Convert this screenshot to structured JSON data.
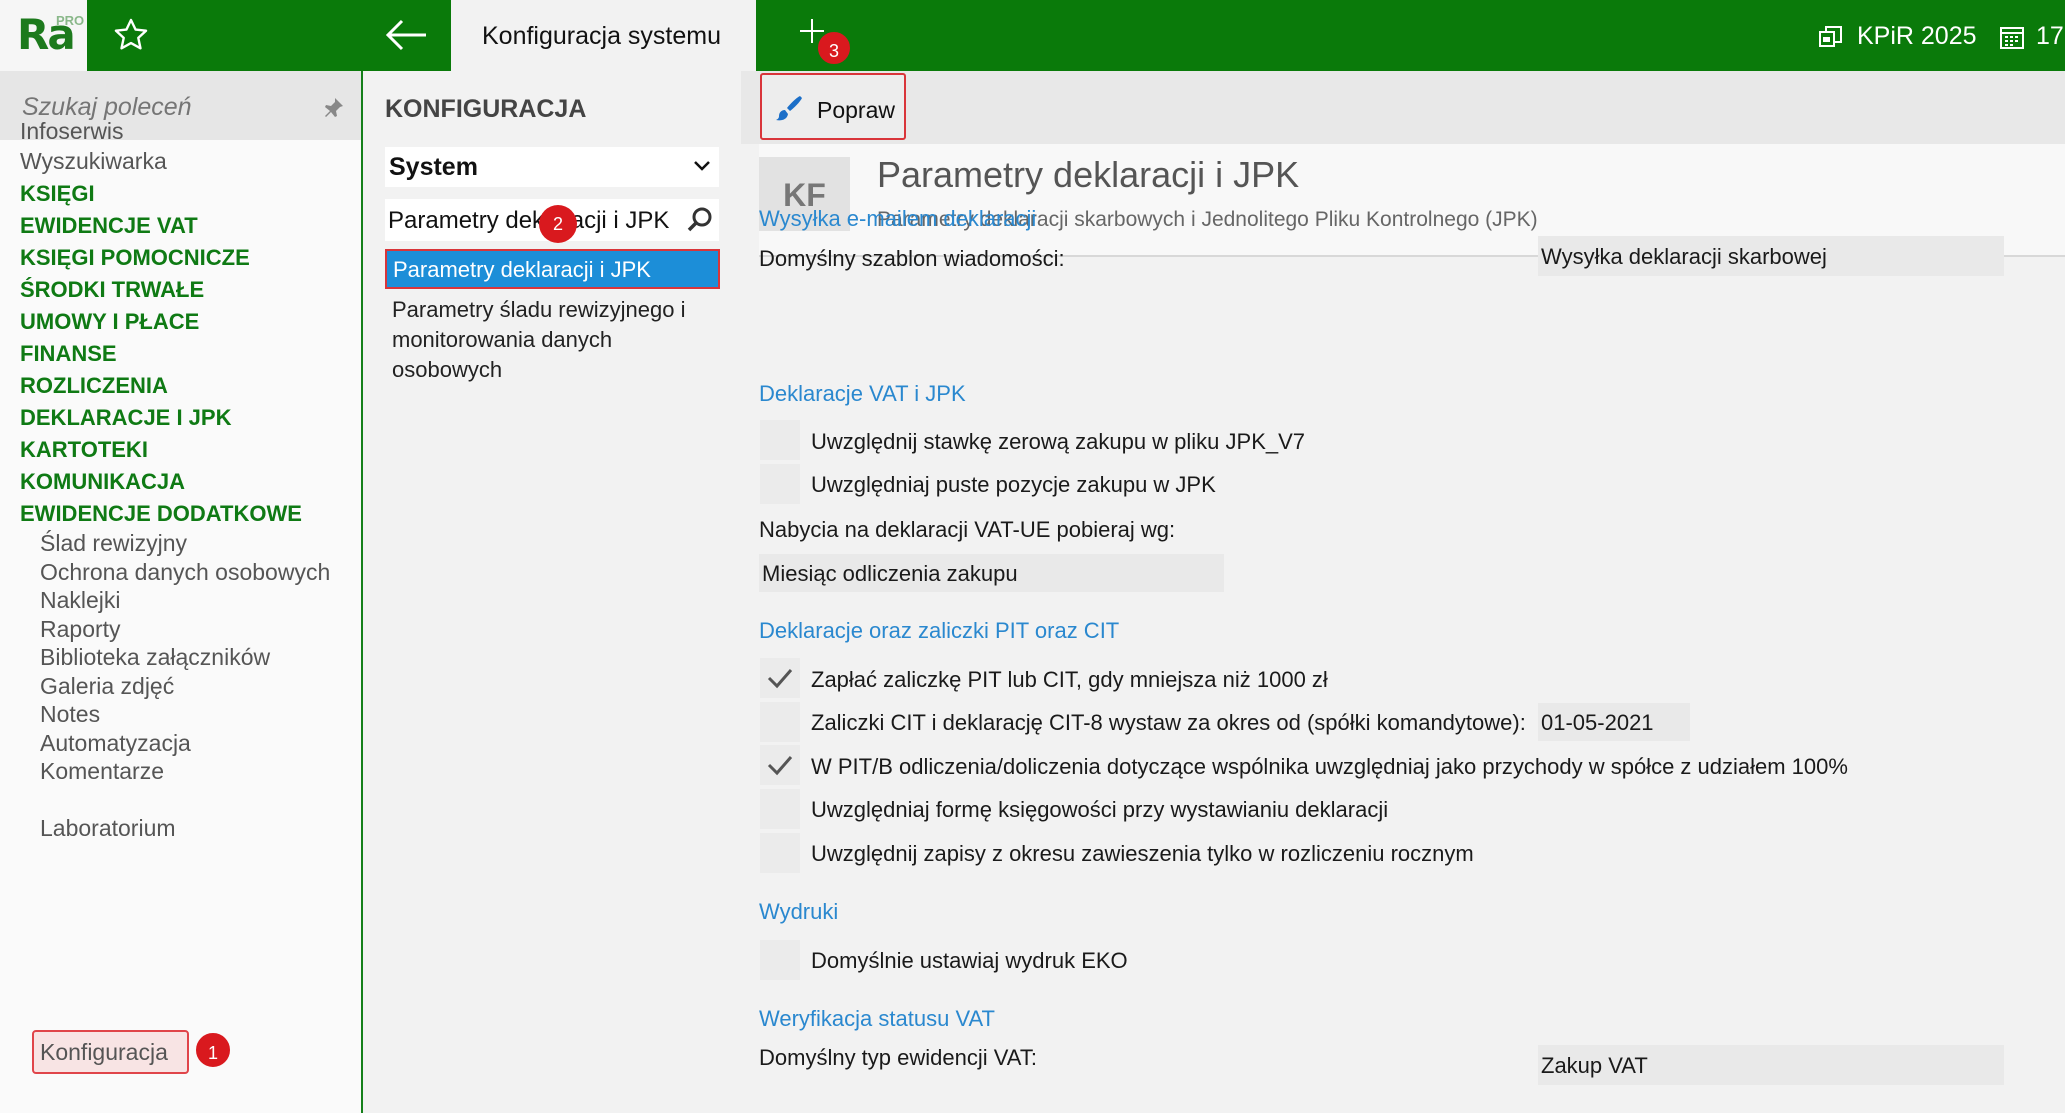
{
  "topbar": {
    "logo_text": "Ra",
    "logo_pro": "PRO",
    "tab_title": "Konfiguracja systemu",
    "badge_3": "3",
    "kpir_label": "KPiR 2025",
    "cal_label": "17"
  },
  "sidebar": {
    "search_placeholder": "Szukaj poleceń",
    "plain_items": [
      "Infoserwis",
      "Wyszukiwarka"
    ],
    "sections": [
      "KSIĘGI",
      "EWIDENCJE VAT",
      "KSIĘGI POMOCNICZE",
      "ŚRODKI TRWAŁE",
      "UMOWY I PŁACE",
      "FINANSE",
      "ROZLICZENIA",
      "DEKLARACJE I JPK",
      "KARTOTEKI",
      "KOMUNIKACJA",
      "EWIDENCJE DODATKOWE"
    ],
    "sub_items": [
      "Ślad rewizyjny",
      "Ochrona danych osobowych",
      "Naklejki",
      "Raporty",
      "Biblioteka załączników",
      "Galeria zdjęć",
      "Notes",
      "Automatyzacja",
      "Komentarze",
      "Konfiguracja",
      "Laboratorium"
    ],
    "badge_1": "1"
  },
  "middle": {
    "title": "KONFIGURACJA",
    "select_value": "System",
    "search_value": "Parametry deklaracji i JPK",
    "badge_2": "2",
    "selected_item": "Parametry deklaracji i JPK",
    "item_2": "Parametry śladu rewizyjnego i monitorowania danych osobowych"
  },
  "toolbar": {
    "popraw_label": "Popraw"
  },
  "header": {
    "initials": "KF",
    "title": "Parametry deklaracji i JPK",
    "subtitle": "Parametry deklaracji skarbowych i Jednolitego Pliku Kontrolnego (JPK)"
  },
  "form": {
    "email": {
      "section": "Wysyłka e-mailem deklaracji",
      "template_label": "Domyślny szablon wiadomości:",
      "template_value": "Wysyłka deklaracji skarbowej"
    },
    "vat": {
      "section": "Deklaracje VAT i JPK",
      "cb1": "Uwzględnij stawkę zerową zakupu w pliku JPK_V7",
      "cb2": "Uwzględniaj puste pozycje zakupu w JPK",
      "acq_label": "Nabycia na deklaracji VAT-UE pobieraj wg:",
      "acq_value": "Miesiąc odliczenia zakupu"
    },
    "pit": {
      "section": "Deklaracje oraz zaliczki PIT oraz CIT",
      "cb1": "Zapłać zaliczkę PIT lub CIT, gdy mniejsza niż 1000 zł",
      "cb1_checked": true,
      "cb2": "Zaliczki CIT i deklarację CIT-8 wystaw za okres od (spółki komandytowe):",
      "cb2_checked": false,
      "cb2_date": "01-05-2021",
      "cb3": "W PIT/B odliczenia/doliczenia dotyczące wspólnika uwzględniaj jako przychody w spółce z udziałem 100%",
      "cb3_checked": true,
      "cb4": "Uwzględniaj formę księgowości przy wystawianiu deklaracji",
      "cb4_checked": false,
      "cb5": "Uwzględnij zapisy z okresu zawieszenia tylko w rozliczeniu rocznym",
      "cb5_checked": false
    },
    "prints": {
      "section": "Wydruki",
      "cb1": "Domyślnie ustawiaj wydruk EKO"
    },
    "vat_status": {
      "section": "Weryfikacja statusu VAT",
      "type_label": "Domyślny typ ewidencji VAT:",
      "type_value": "Zakup VAT"
    }
  },
  "colors": {
    "brand_green": "#0a7a0a",
    "section_blue": "#2a88cf",
    "selected_blue": "#1c8ed8",
    "badge_red": "#d9191e"
  }
}
